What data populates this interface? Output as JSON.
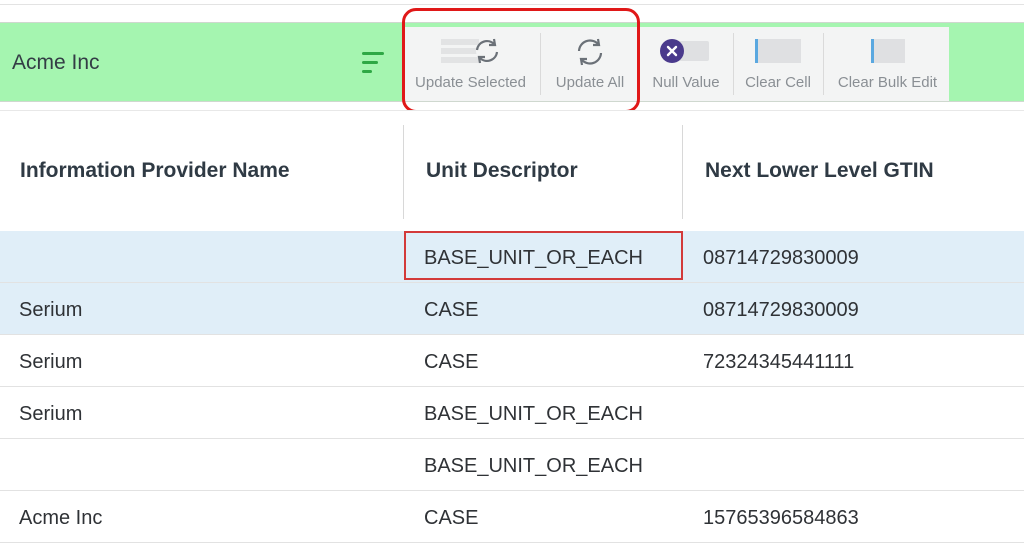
{
  "header": {
    "company": "Acme Inc",
    "menu_icon": "hamburger-menu-icon"
  },
  "toolbar": {
    "update_selected": {
      "label": "Update Selected",
      "icon": "sync-list-icon"
    },
    "update_all": {
      "label": "Update All",
      "icon": "sync-icon"
    },
    "null_value": {
      "label": "Null Value",
      "icon": "null-toggle-icon"
    },
    "clear_cell": {
      "label": "Clear Cell",
      "icon": "clear-cell-icon"
    },
    "clear_bulk_edit": {
      "label": "Clear Bulk Edit",
      "icon": "clear-bulk-icon"
    }
  },
  "colors": {
    "toolbar_bg": "#a5f5b0",
    "accent_green": "#2ea845",
    "highlight_red": "#e01818",
    "selected_row": "#e0eef8",
    "null_icon": "#4a3a8c"
  },
  "table": {
    "columns": [
      "Information Provider Name",
      "Unit Descriptor",
      "Next Lower Level GTIN"
    ],
    "rows": [
      {
        "provider": "",
        "descriptor": "BASE_UNIT_OR_EACH",
        "gtin": "08714729830009",
        "selected": true
      },
      {
        "provider": "Serium",
        "descriptor": "CASE",
        "gtin": "08714729830009",
        "selected": true
      },
      {
        "provider": "Serium",
        "descriptor": "CASE",
        "gtin": "72324345441111",
        "selected": false
      },
      {
        "provider": "Serium",
        "descriptor": "BASE_UNIT_OR_EACH",
        "gtin": "",
        "selected": false
      },
      {
        "provider": "",
        "descriptor": "BASE_UNIT_OR_EACH",
        "gtin": "",
        "selected": false
      },
      {
        "provider": "Acme Inc",
        "descriptor": "CASE",
        "gtin": "15765396584863",
        "selected": false
      }
    ]
  }
}
